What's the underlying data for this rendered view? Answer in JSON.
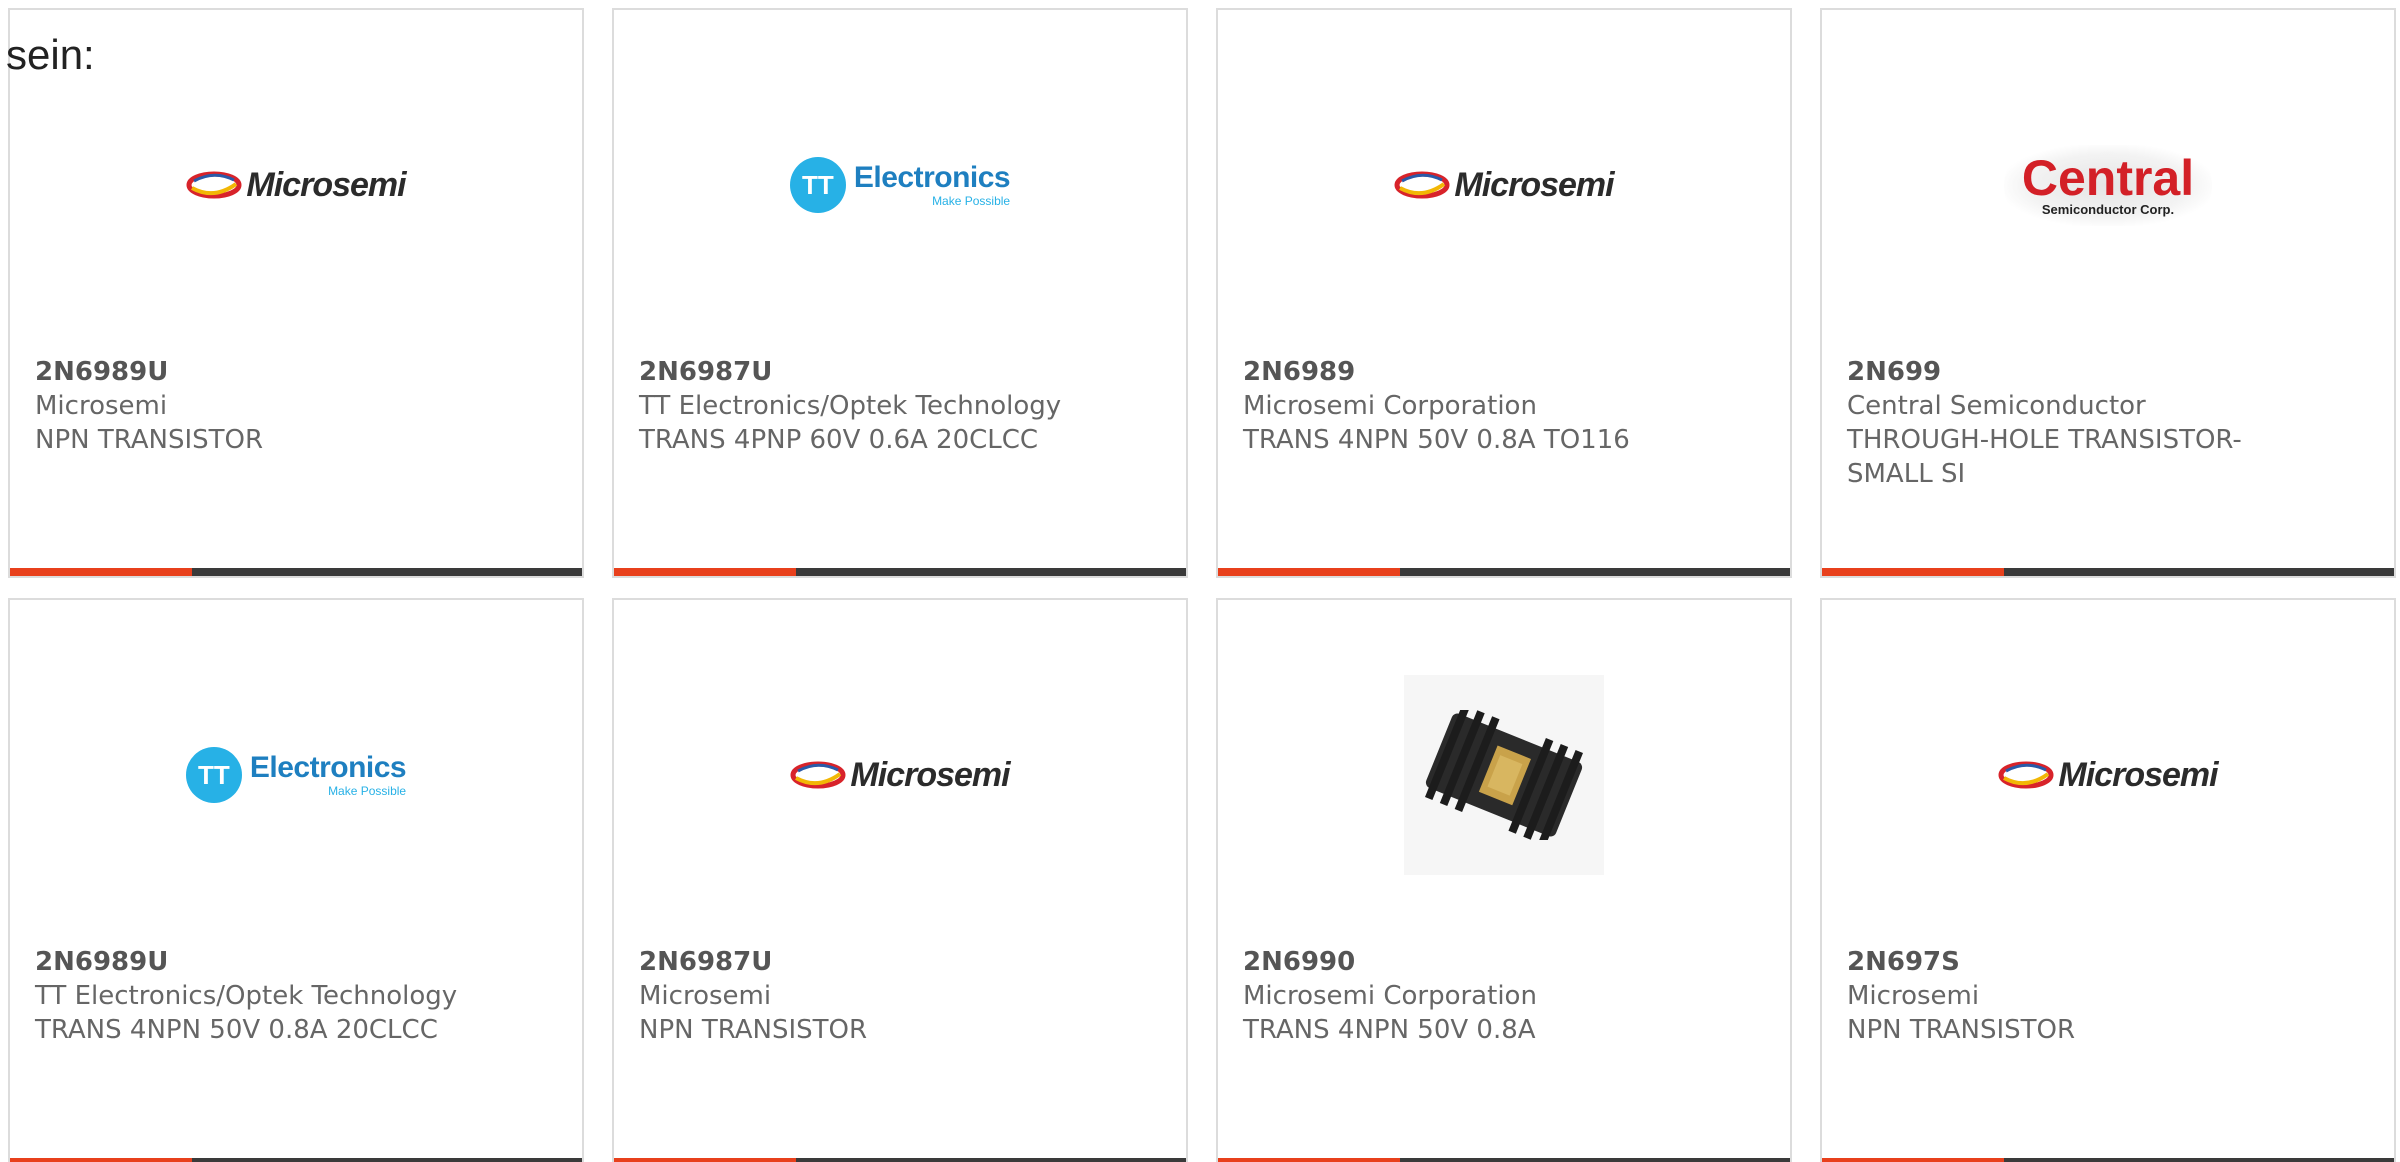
{
  "heading": "sein:",
  "colors": {
    "accent": "#e8401c",
    "bar": "#3a3a3a",
    "microsemi_red": "#d8232a",
    "tt_blue": "#27b1e6",
    "central_red": "#d32027"
  },
  "cards": [
    {
      "part": "2N6989U",
      "manufacturer": "Microsemi",
      "description": "NPN TRANSISTOR",
      "logo": "microsemi-logo",
      "logo_text": "Microsemi"
    },
    {
      "part": "2N6987U",
      "manufacturer": "TT Electronics/Optek Technology",
      "description": "TRANS 4PNP 60V 0.6A 20CLCC",
      "logo": "tt-electronics-logo",
      "logo_text": "Electronics",
      "logo_initials": "TT",
      "logo_tagline": "Make Possible"
    },
    {
      "part": "2N6989",
      "manufacturer": "Microsemi Corporation",
      "description": "TRANS 4NPN 50V 0.8A TO116",
      "logo": "microsemi-logo",
      "logo_text": "Microsemi"
    },
    {
      "part": "2N699",
      "manufacturer": "Central Semiconductor",
      "description": "THROUGH-HOLE TRANSISTOR-SMALL SI",
      "logo": "central-semiconductor-logo",
      "logo_text": "Central",
      "logo_sub": "Semiconductor Corp."
    },
    {
      "part": "2N6989U",
      "manufacturer": "TT Electronics/Optek Technology",
      "description": "TRANS 4NPN 50V 0.8A 20CLCC",
      "logo": "tt-electronics-logo",
      "logo_text": "Electronics",
      "logo_initials": "TT",
      "logo_tagline": "Make Possible"
    },
    {
      "part": "2N6987U",
      "manufacturer": "Microsemi",
      "description": "NPN TRANSISTOR",
      "logo": "microsemi-logo",
      "logo_text": "Microsemi"
    },
    {
      "part": "2N6990",
      "manufacturer": "Microsemi Corporation",
      "description": "TRANS 4NPN 50V 0.8A",
      "logo": "chip-package-image"
    },
    {
      "part": "2N697S",
      "manufacturer": "Microsemi",
      "description": "NPN TRANSISTOR",
      "logo": "microsemi-logo",
      "logo_text": "Microsemi"
    }
  ]
}
